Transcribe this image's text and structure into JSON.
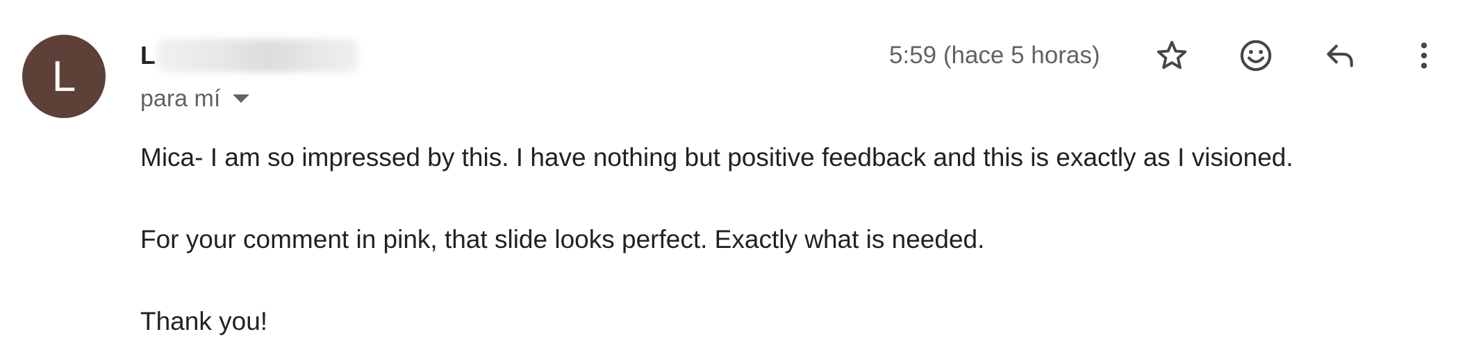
{
  "avatar": {
    "letter": "L",
    "color": "#5d4037"
  },
  "sender": {
    "initial": "L"
  },
  "recipient": {
    "label": "para mí"
  },
  "timestamp": "5:59 (hace 5 horas)",
  "actions": {
    "star": "star-icon",
    "emoji": "emoji-icon",
    "reply": "reply-icon",
    "more": "more-vert-icon"
  },
  "message": {
    "paragraphs": [
      "Mica- I am so impressed by this. I have nothing but positive feedback and this is exactly as I visioned.",
      "For your comment in pink, that slide looks perfect. Exactly what is needed.",
      "Thank you!"
    ]
  },
  "colors": {
    "text": "#202124",
    "secondary_text": "#5f6368",
    "icon": "#444746"
  }
}
